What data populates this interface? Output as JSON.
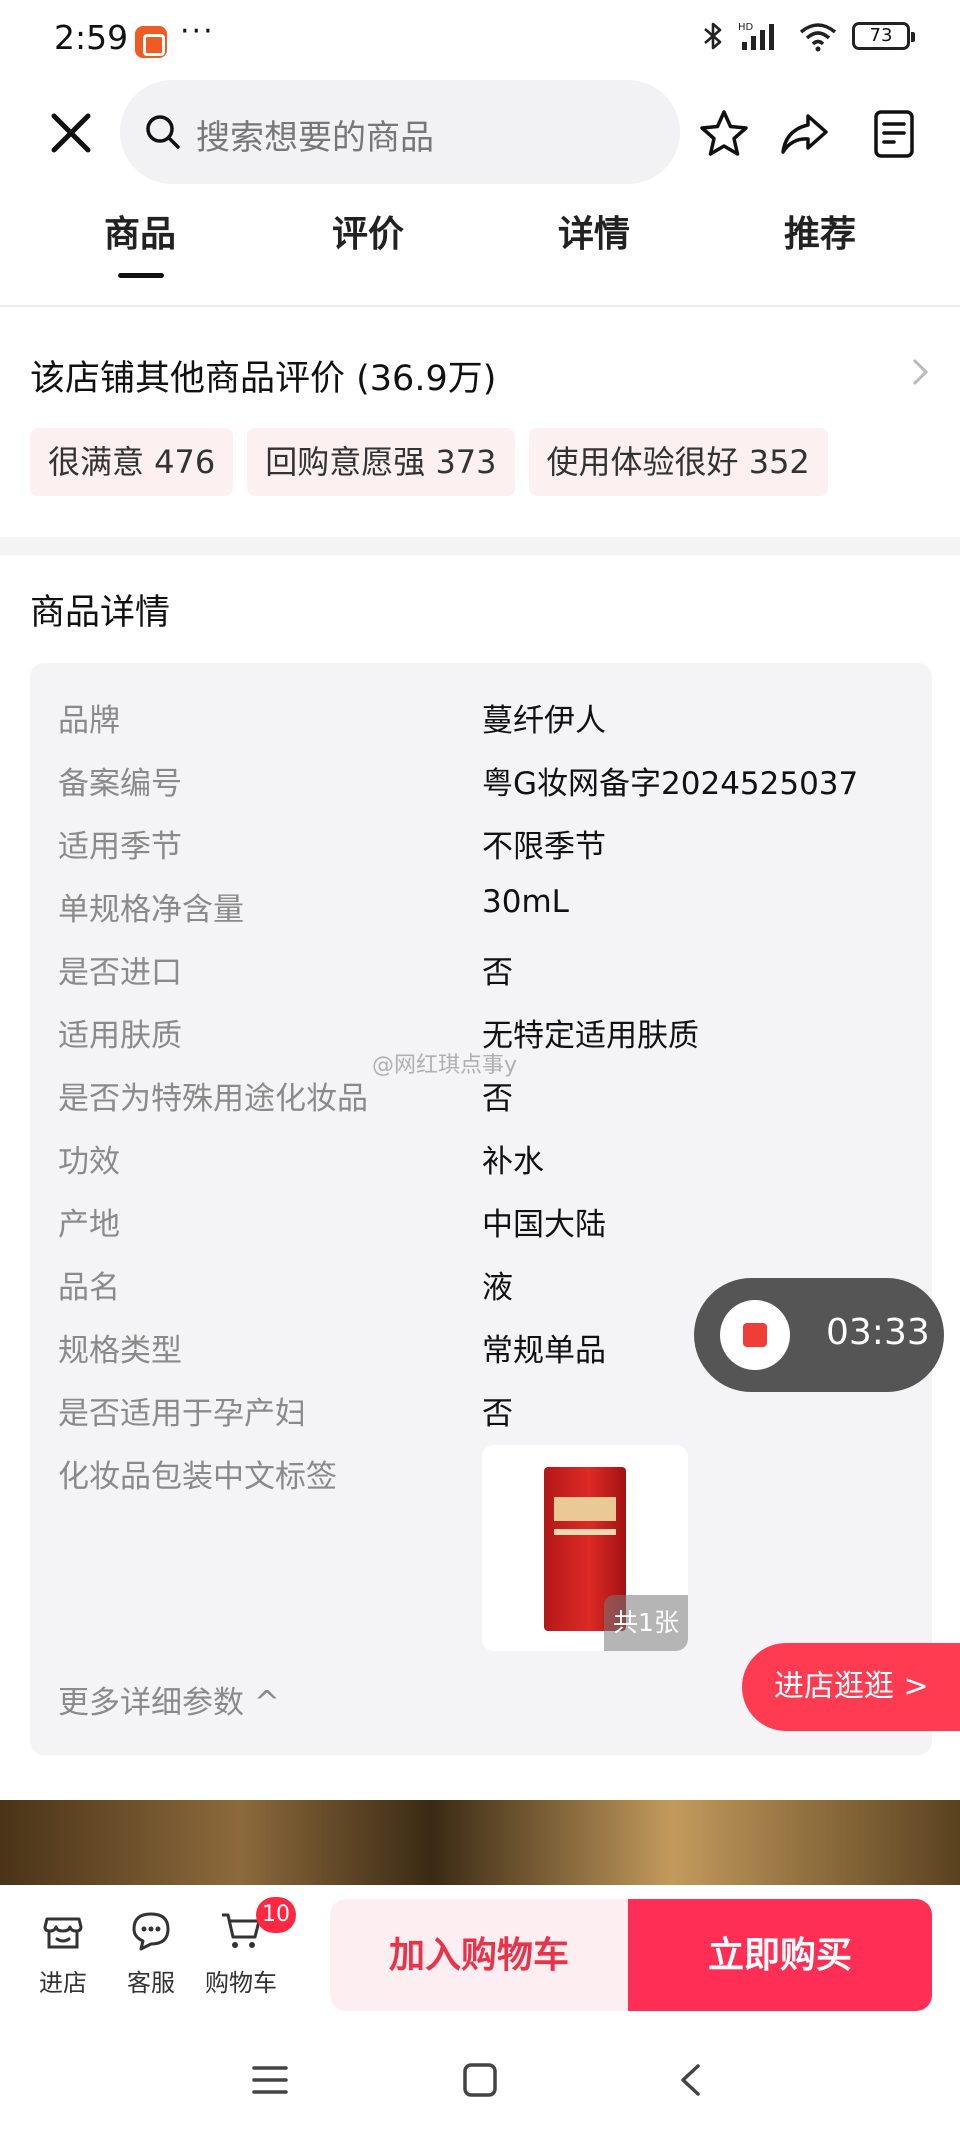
{
  "status_bar": {
    "time": "2:59",
    "more": "···",
    "battery": "73",
    "network_label": "HD"
  },
  "header": {
    "search_placeholder": "搜索想要的商品",
    "icons": [
      "close-icon",
      "search-icon",
      "star-icon",
      "share-icon",
      "notes-icon"
    ]
  },
  "tabs": [
    {
      "label": "商品",
      "active": true
    },
    {
      "label": "评价",
      "active": false
    },
    {
      "label": "详情",
      "active": false
    },
    {
      "label": "推荐",
      "active": false
    }
  ],
  "reviews": {
    "title": "该店铺其他商品评价 (36.9万)",
    "tags": [
      {
        "label": "很满意 476"
      },
      {
        "label": "回购意愿强 373"
      },
      {
        "label": "使用体验很好 352"
      }
    ]
  },
  "details": {
    "title": "商品详情",
    "specs": [
      {
        "label": "品牌",
        "value": "蔓纤伊人"
      },
      {
        "label": "备案编号",
        "value": "粤G妆网备字2024525037"
      },
      {
        "label": "适用季节",
        "value": "不限季节"
      },
      {
        "label": "单规格净含量",
        "value": "30mL"
      },
      {
        "label": "是否进口",
        "value": "否"
      },
      {
        "label": "适用肤质",
        "value": "无特定适用肤质"
      },
      {
        "label": "是否为特殊用途化妆品",
        "value": "否"
      },
      {
        "label": "功效",
        "value": "补水"
      },
      {
        "label": "产地",
        "value": "中国大陆"
      },
      {
        "label": "品名",
        "value": "液"
      },
      {
        "label": "规格类型",
        "value": "常规单品"
      },
      {
        "label": "是否适用于孕产妇",
        "value": "否"
      },
      {
        "label": "化妆品包装中文标签",
        "value": ""
      }
    ],
    "image_count": "共1张",
    "more_params": "更多详细参数 ^"
  },
  "watermark": "@网红琪点事y",
  "recording": {
    "time": "03:33"
  },
  "enter_store": "进店逛逛 >",
  "bottom_bar": {
    "store_label": "进店",
    "service_label": "客服",
    "cart_label": "购物车",
    "cart_count": "10",
    "add_to_cart": "加入购物车",
    "buy_now": "立即购买"
  },
  "colors": {
    "accent": "#ff2e55",
    "tag_bg": "#fcf0f1",
    "card_bg": "#f4f4f6",
    "recording_pill": "#555555"
  }
}
